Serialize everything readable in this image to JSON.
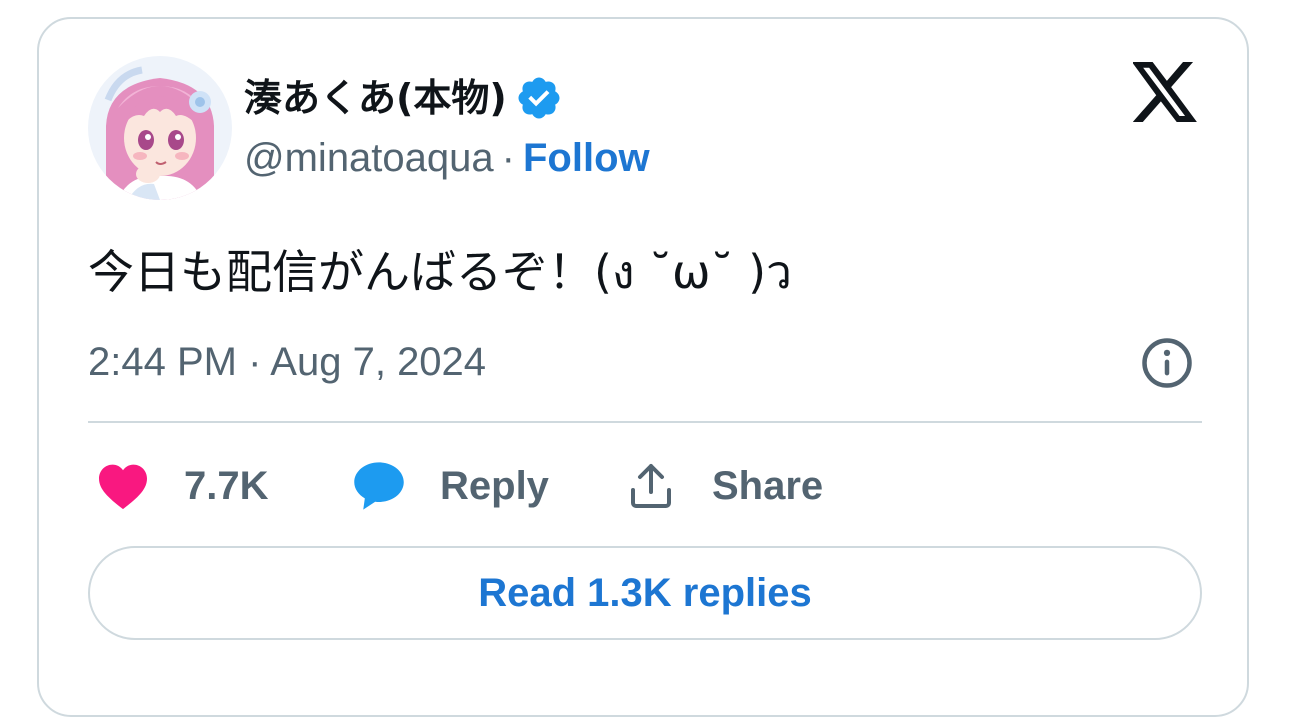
{
  "user": {
    "display_name": "湊あくあ(本物)",
    "handle": "@minatoaqua",
    "separator": "·",
    "follow_label": "Follow"
  },
  "tweet": {
    "text": "今日も配信がんばるぞ！(ง ˘ω˘ )ว",
    "timestamp": "2:44 PM · Aug 7, 2024"
  },
  "actions": {
    "likes": "7.7K",
    "reply_label": "Reply",
    "share_label": "Share"
  },
  "read_replies_label": "Read 1.3K replies",
  "icons": {
    "verified": "verified-badge-icon",
    "logo": "x-logo-icon",
    "info": "info-icon",
    "like": "heart-icon",
    "reply": "speech-bubble-icon",
    "share": "share-upload-icon"
  },
  "colors": {
    "accent": "#1d76d2",
    "verified": "#1d9bf0",
    "like": "#f91880",
    "muted": "#536471",
    "text": "#0f1419",
    "border": "#cfd9de"
  }
}
